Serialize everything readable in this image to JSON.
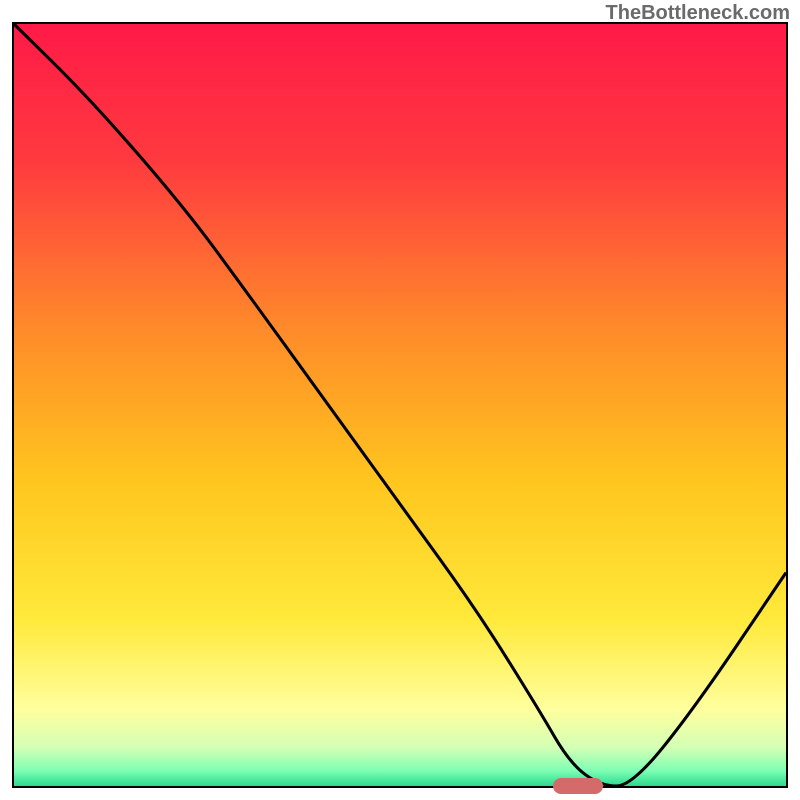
{
  "attribution": "TheBottleneck.com",
  "colors": {
    "border": "#000000",
    "marker": "#d46a6a",
    "gradient_stops": [
      {
        "pct": 0,
        "color": "#ff1a47"
      },
      {
        "pct": 18,
        "color": "#ff3a3f"
      },
      {
        "pct": 40,
        "color": "#ff8a2a"
      },
      {
        "pct": 60,
        "color": "#ffc61e"
      },
      {
        "pct": 78,
        "color": "#ffe93a"
      },
      {
        "pct": 90,
        "color": "#ffff9e"
      },
      {
        "pct": 95,
        "color": "#d3ffb5"
      },
      {
        "pct": 98,
        "color": "#7dffb4"
      },
      {
        "pct": 100,
        "color": "#2bd98f"
      }
    ]
  },
  "chart_data": {
    "type": "line",
    "title": "",
    "xlabel": "",
    "ylabel": "",
    "xlim": [
      0,
      100
    ],
    "ylim": [
      0,
      100
    ],
    "grid": false,
    "legend": false,
    "series": [
      {
        "name": "curve",
        "x": [
          0,
          10,
          22,
          30,
          40,
          50,
          60,
          68,
          72,
          76,
          80,
          88,
          100
        ],
        "y": [
          100,
          90,
          76,
          65,
          51,
          37,
          23,
          10,
          3,
          0,
          0,
          10,
          28
        ]
      }
    ],
    "marker": {
      "x": 73,
      "y": 0
    }
  }
}
